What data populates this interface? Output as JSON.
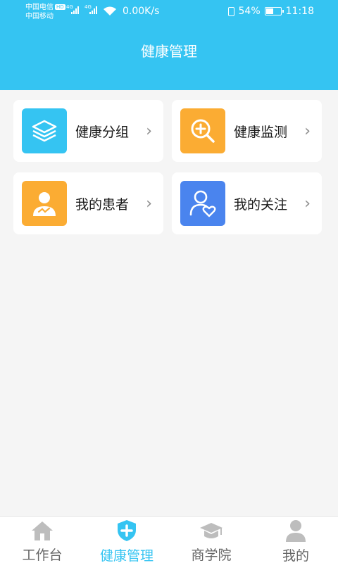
{
  "status_bar": {
    "carrier1": "中国电信",
    "hd": "HD",
    "carrier2": "中国移动",
    "net_type": "4G",
    "speed": "0.00K/s",
    "battery_pct": "54%",
    "battery_level": 0.54,
    "time": "11:18"
  },
  "header": {
    "title": "健康管理"
  },
  "cards": [
    {
      "label": "健康分组",
      "icon": "layers-icon",
      "color": "#35c4f2"
    },
    {
      "label": "健康监测",
      "icon": "zoom-plus-icon",
      "color": "#fbac33"
    },
    {
      "label": "我的患者",
      "icon": "patient-icon",
      "color": "#fbac33"
    },
    {
      "label": "我的关注",
      "icon": "user-heart-icon",
      "color": "#4a84ee"
    }
  ],
  "bottom_nav": [
    {
      "label": "工作台",
      "icon": "home-icon",
      "active": false
    },
    {
      "label": "健康管理",
      "icon": "shield-plus-icon",
      "active": true
    },
    {
      "label": "商学院",
      "icon": "graduation-cap-icon",
      "active": false
    },
    {
      "label": "我的",
      "icon": "user-icon",
      "active": false
    }
  ],
  "colors": {
    "accent": "#35c4f2",
    "inactive": "#bdbdbd"
  }
}
